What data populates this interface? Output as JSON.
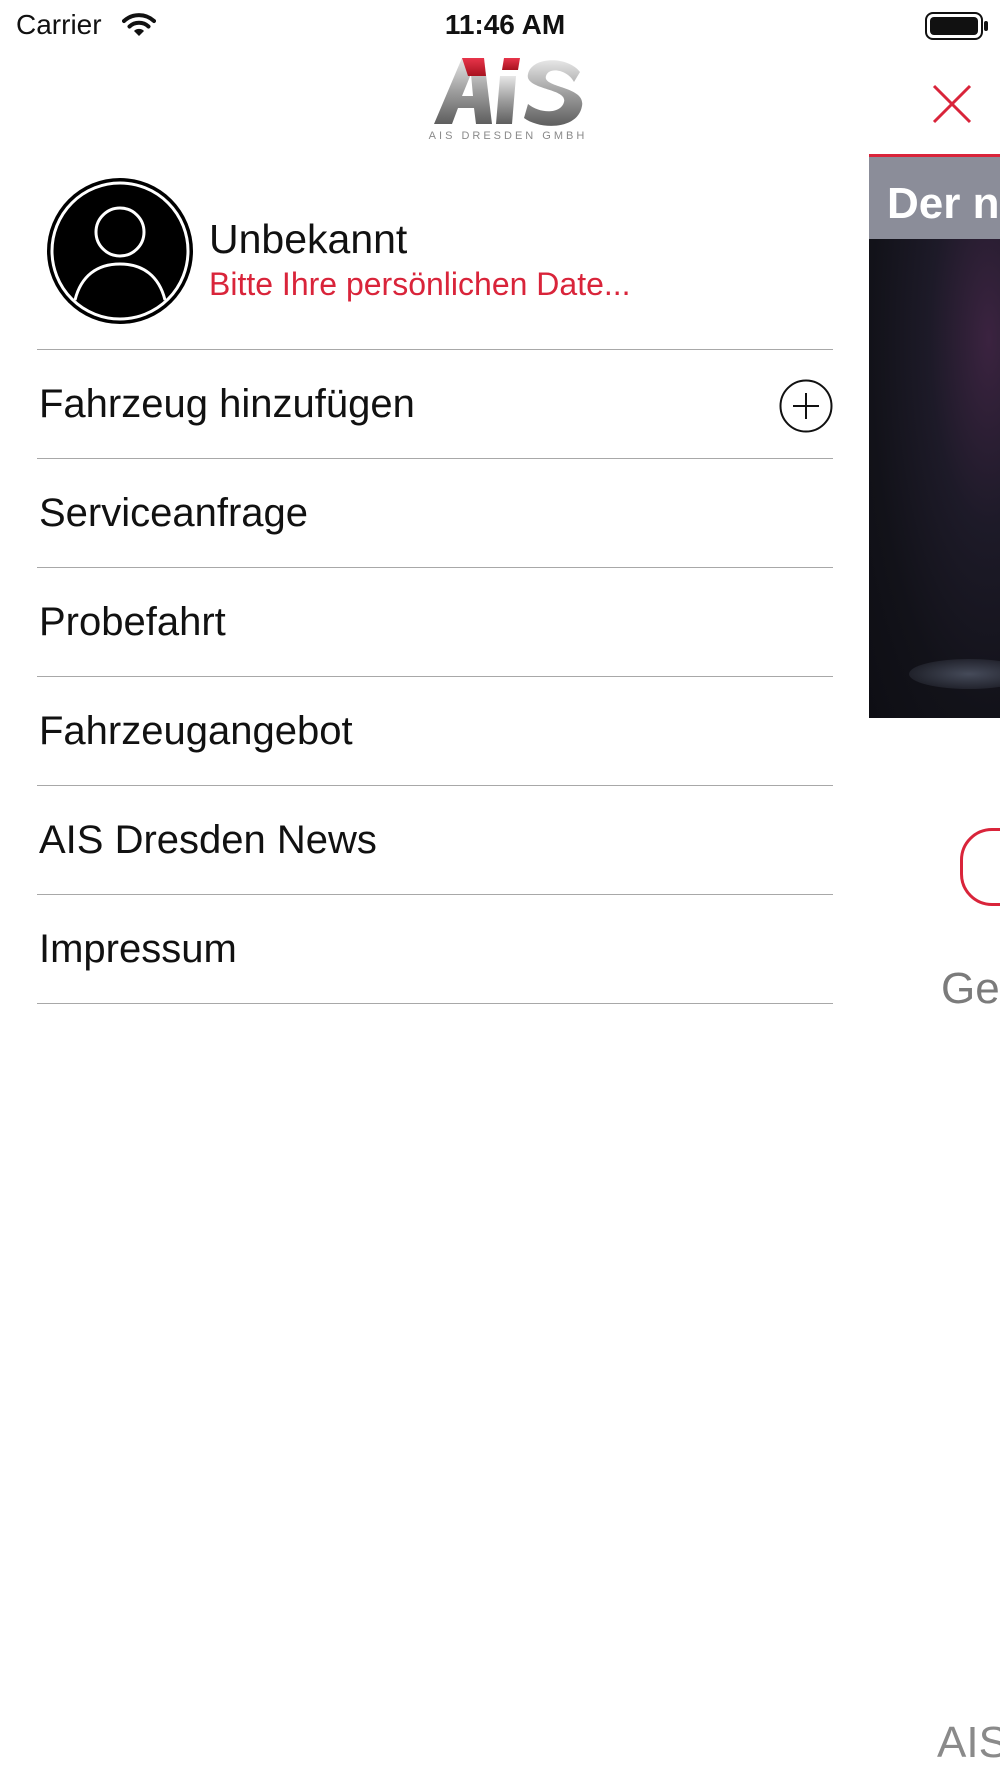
{
  "status_bar": {
    "carrier": "Carrier",
    "time": "11:46 AM"
  },
  "logo": {
    "brand": "AIS",
    "subtitle": "AIS DRESDEN GMBH"
  },
  "profile": {
    "name": "Unbekannt",
    "subtitle": "Bitte Ihre persönlichen Date..."
  },
  "menu": {
    "items": [
      {
        "label": "Fahrzeug hinzufügen",
        "icon": "plus-circle-icon"
      },
      {
        "label": "Serviceanfrage"
      },
      {
        "label": "Probefahrt"
      },
      {
        "label": "Fahrzeugangebot"
      },
      {
        "label": "AIS Dresden News"
      },
      {
        "label": "Impressum"
      }
    ]
  },
  "background": {
    "banner_title": "Der n",
    "text": "Ge",
    "footer": "AIS"
  },
  "colors": {
    "accent": "#d9243a",
    "divider": "#a8a8a8",
    "banner_title_bg": "#8b8d99"
  }
}
